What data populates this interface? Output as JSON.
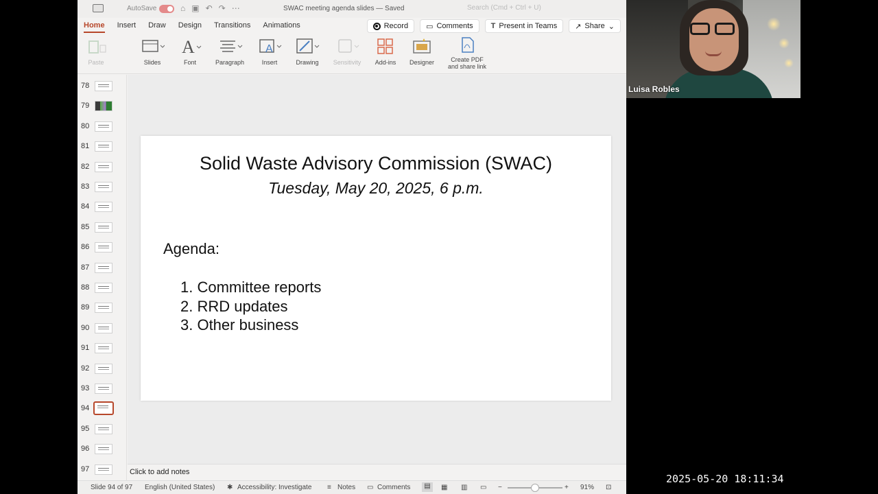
{
  "titlebar": {
    "autosave_label": "AutoSave",
    "document_title": "SWAC meeting agenda slides — Saved",
    "search_placeholder": "Search (Cmd + Ctrl + U)"
  },
  "ribbon_tabs": [
    "Home",
    "Insert",
    "Draw",
    "Design",
    "Transitions",
    "Animations"
  ],
  "active_tab": "Home",
  "top_buttons": {
    "record": "Record",
    "comments": "Comments",
    "present_in_teams": "Present in Teams",
    "share": "Share"
  },
  "ribbon_groups": [
    {
      "label": "Paste",
      "icon": "paste-icon",
      "enabled": false
    },
    {
      "label": "Slides",
      "icon": "slides-icon",
      "enabled": true
    },
    {
      "label": "Font",
      "icon": "font-icon",
      "enabled": true
    },
    {
      "label": "Paragraph",
      "icon": "paragraph-icon",
      "enabled": true
    },
    {
      "label": "Insert",
      "icon": "insert-icon",
      "enabled": true
    },
    {
      "label": "Drawing",
      "icon": "drawing-icon",
      "enabled": true
    },
    {
      "label": "Sensitivity",
      "icon": "sensitivity-icon",
      "enabled": false
    },
    {
      "label": "Add-ins",
      "icon": "addins-icon",
      "enabled": true
    },
    {
      "label": "Designer",
      "icon": "designer-icon",
      "enabled": true
    },
    {
      "label": "Create PDF and share link",
      "icon": "pdf-icon",
      "enabled": true
    }
  ],
  "slide_numbers": [
    "78",
    "79",
    "80",
    "81",
    "82",
    "83",
    "84",
    "85",
    "86",
    "87",
    "88",
    "89",
    "90",
    "91",
    "92",
    "93",
    "94",
    "95",
    "96",
    "97"
  ],
  "selected_slide": "94",
  "slide": {
    "title": "Solid Waste Advisory Commission (SWAC)",
    "subtitle": "Tuesday, May 20, 2025, 6 p.m.",
    "agenda_label": "Agenda:",
    "agenda_items": [
      "1. Committee reports",
      "2. RRD updates",
      "3. Other business"
    ]
  },
  "notes_placeholder": "Click to add notes",
  "status": {
    "slide_position": "Slide 94 of 97",
    "language": "English (United States)",
    "accessibility": "Accessibility: Investigate",
    "notes": "Notes",
    "comments": "Comments",
    "zoom": "91%",
    "zoom_fraction": 0.5
  },
  "video": {
    "participant_name": "Luisa Robles"
  },
  "timestamp": "2025-05-20 18:11:34",
  "colors": {
    "accent": "#b7472a",
    "background": "#000000"
  }
}
